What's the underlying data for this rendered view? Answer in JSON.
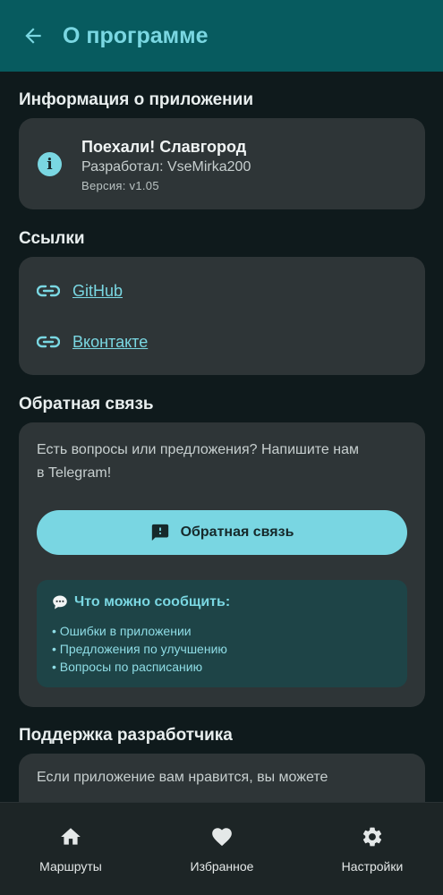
{
  "header": {
    "title": "О программе",
    "back_icon": "arrow-left-icon"
  },
  "app_info": {
    "section_title": "Информация о приложении",
    "name": "Поехали! Славгород",
    "developer": "Разработал: VseMirka200",
    "version": "Версия: v1.05"
  },
  "links": {
    "section_title": "Ссылки",
    "items": [
      {
        "label": "GitHub",
        "icon": "link-icon"
      },
      {
        "label": "Вконтакте",
        "icon": "link-icon"
      }
    ]
  },
  "feedback": {
    "section_title": "Обратная связь",
    "text_line1": "Есть вопросы или предложения? Напишите нам",
    "text_line2": "в Telegram!",
    "button_label": "Обратная связь",
    "tips_title": "Что можно сообщить:",
    "tips": [
      "• Ошибки в приложении",
      "• Предложения по улучшению",
      "• Вопросы по расписанию"
    ]
  },
  "support": {
    "section_title": "Поддержка разработчика",
    "text": "Если приложение вам нравится, вы можете"
  },
  "bottom_nav": {
    "items": [
      {
        "label": "Маршруты",
        "icon": "home-icon"
      },
      {
        "label": "Избранное",
        "icon": "heart-icon"
      },
      {
        "label": "Настройки",
        "icon": "gear-icon"
      }
    ]
  },
  "colors": {
    "accent": "#7ad7e2",
    "header_bg": "#075b5f",
    "background": "#0f1a1c",
    "card": "#2e3537",
    "tips_bg": "#1e4447"
  }
}
